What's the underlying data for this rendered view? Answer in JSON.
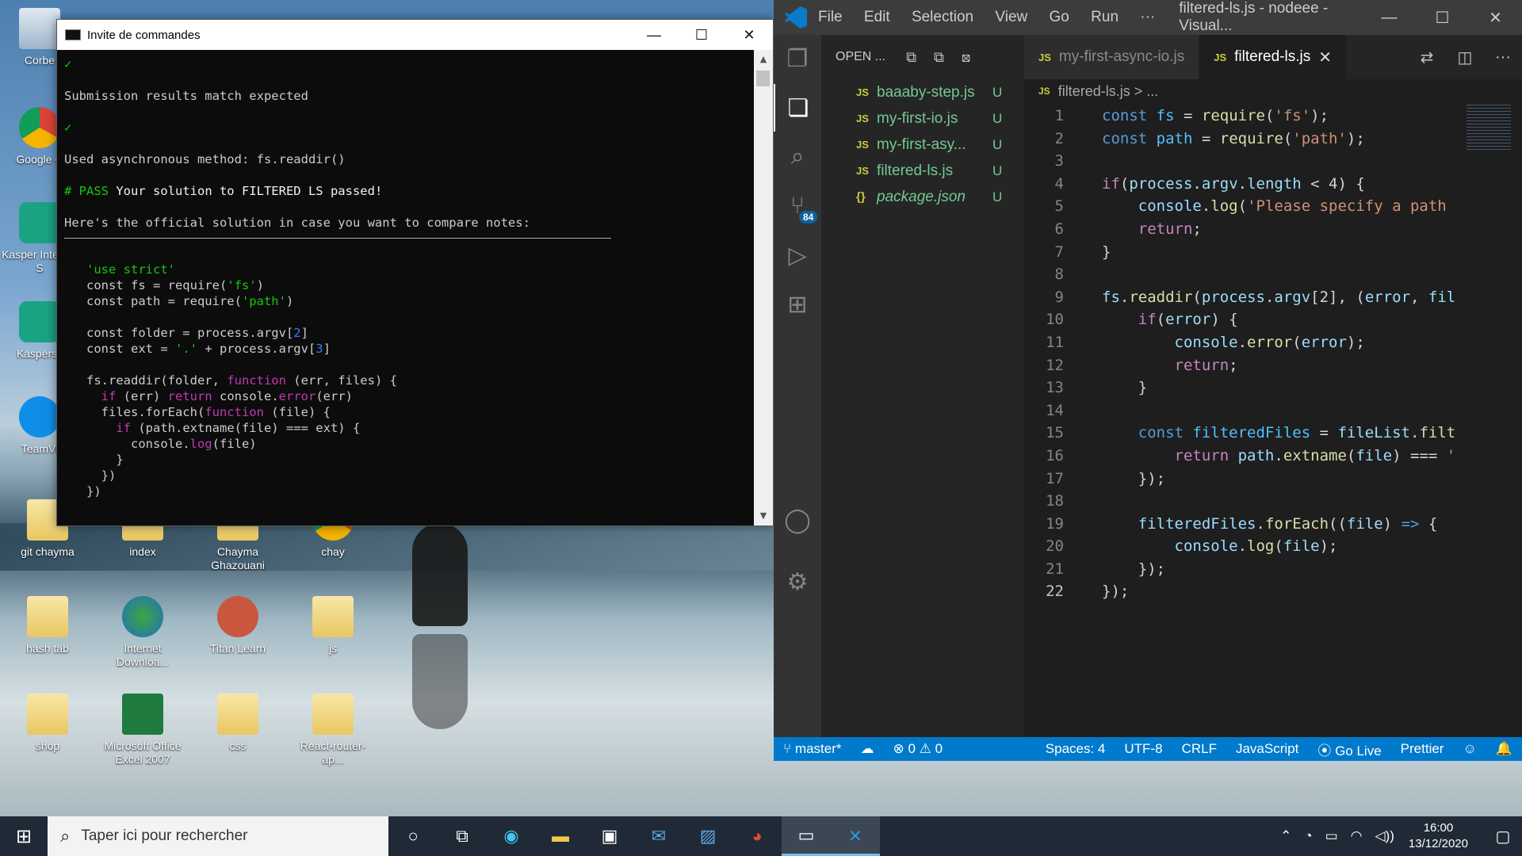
{
  "desktop": {
    "icons": [
      {
        "label": "Corbe",
        "type": "recycle"
      },
      {
        "label": "Google C",
        "type": "chrome"
      },
      {
        "label": "Kasper Internet S",
        "type": "kasp"
      },
      {
        "label": "Kaspersk",
        "type": "kasp"
      },
      {
        "label": "TeamVi",
        "type": "teamv"
      },
      {
        "label": "git chayma",
        "type": "folder"
      },
      {
        "label": "index",
        "type": "folder"
      },
      {
        "label": "Chayma Ghazouani",
        "type": "folder"
      },
      {
        "label": "chay",
        "type": "chrome"
      },
      {
        "label": "hash tab",
        "type": "folder"
      },
      {
        "label": "Internet Downloa...",
        "type": "idm"
      },
      {
        "label": "Titan Learn",
        "type": "titan"
      },
      {
        "label": "js",
        "type": "folder"
      },
      {
        "label": "shop",
        "type": "folder"
      },
      {
        "label": "Microsoft Office Excel 2007",
        "type": "excel"
      },
      {
        "label": "css",
        "type": "folder"
      },
      {
        "label": "React-router-ap...",
        "type": "folder"
      }
    ]
  },
  "cmd": {
    "title": "Invite de commandes",
    "lines": {
      "check1": "✓",
      "l1": "Submission results match expected",
      "check2": "✓",
      "l2": "Used asynchronous method: fs.readdir()",
      "pass_hash": "# PASS",
      "pass_rest": " Your solution to FILTERED LS passed!",
      "l3": "Here's the official solution in case you want to compare notes:"
    }
  },
  "vscode": {
    "menu": [
      "File",
      "Edit",
      "Selection",
      "View",
      "Go",
      "Run",
      "···"
    ],
    "title": "filtered-ls.js - nodeee - Visual...",
    "explorer_header": "OPEN ...",
    "files": [
      {
        "type": "JS",
        "name": "baaaby-step.js",
        "status": "U",
        "italic": false
      },
      {
        "type": "JS",
        "name": "my-first-io.js",
        "status": "U",
        "italic": false
      },
      {
        "type": "JS",
        "name": "my-first-asy...",
        "status": "U",
        "italic": false
      },
      {
        "type": "JS",
        "name": "filtered-ls.js",
        "status": "U",
        "italic": false
      },
      {
        "type": "{}",
        "name": "package.json",
        "status": "U",
        "italic": true
      }
    ],
    "tabs": [
      {
        "type": "JS",
        "name": "my-first-async-io.js",
        "active": false
      },
      {
        "type": "JS",
        "name": "filtered-ls.js",
        "active": true
      }
    ],
    "breadcrumb": "filtered-ls.js > ...",
    "scm_badge": "84",
    "current_line": "22",
    "status": {
      "branch": "master*",
      "errors": "0",
      "warnings": "0",
      "spaces": "Spaces: 4",
      "encoding": "UTF-8",
      "eol": "CRLF",
      "language": "JavaScript",
      "golive": "Go Live",
      "prettier": "Prettier"
    }
  },
  "taskbar": {
    "search_placeholder": "Taper ici pour rechercher",
    "time": "16:00",
    "date": "13/12/2020"
  }
}
